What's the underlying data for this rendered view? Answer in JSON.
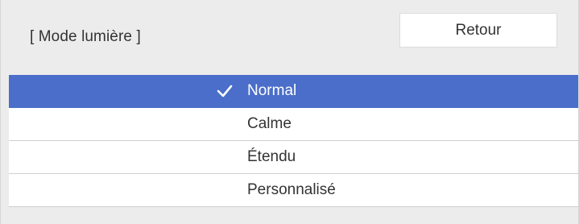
{
  "header": {
    "title": "[ Mode lumière ]",
    "back_label": "Retour"
  },
  "list": {
    "items": [
      {
        "label": "Normal",
        "selected": true
      },
      {
        "label": "Calme",
        "selected": false
      },
      {
        "label": "Étendu",
        "selected": false
      },
      {
        "label": "Personnalisé",
        "selected": false
      }
    ]
  },
  "colors": {
    "selection": "#4a6ec9",
    "panel_background": "#ececec"
  },
  "icons": {
    "selected_marker": "checkmark-icon"
  }
}
